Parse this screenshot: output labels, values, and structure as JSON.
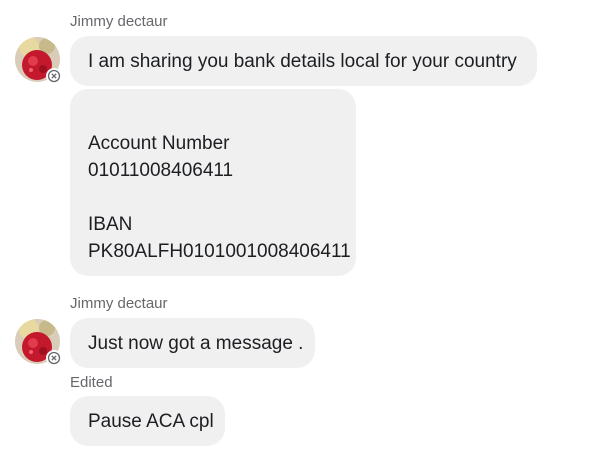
{
  "messages": {
    "group1": {
      "sender": "Jimmy dectaur",
      "bubble1": "I am sharing you bank details local for your country",
      "bubble2_lines": [
        "",
        "Account Number",
        "01011008406411",
        "",
        "IBAN",
        "PK80ALFH0101001008406411"
      ]
    },
    "group2": {
      "sender": "Jimmy dectaur",
      "bubble1": "Just now got a message .",
      "edited_label": "Edited",
      "bubble2": "Pause ACA cpl"
    }
  },
  "avatar": {
    "icon": "avatar",
    "badge_icon": "close-circle-icon"
  },
  "colors": {
    "bubble_bg": "#f0f0f0",
    "meta_text": "#65676b",
    "message_text": "#1c1e21"
  }
}
